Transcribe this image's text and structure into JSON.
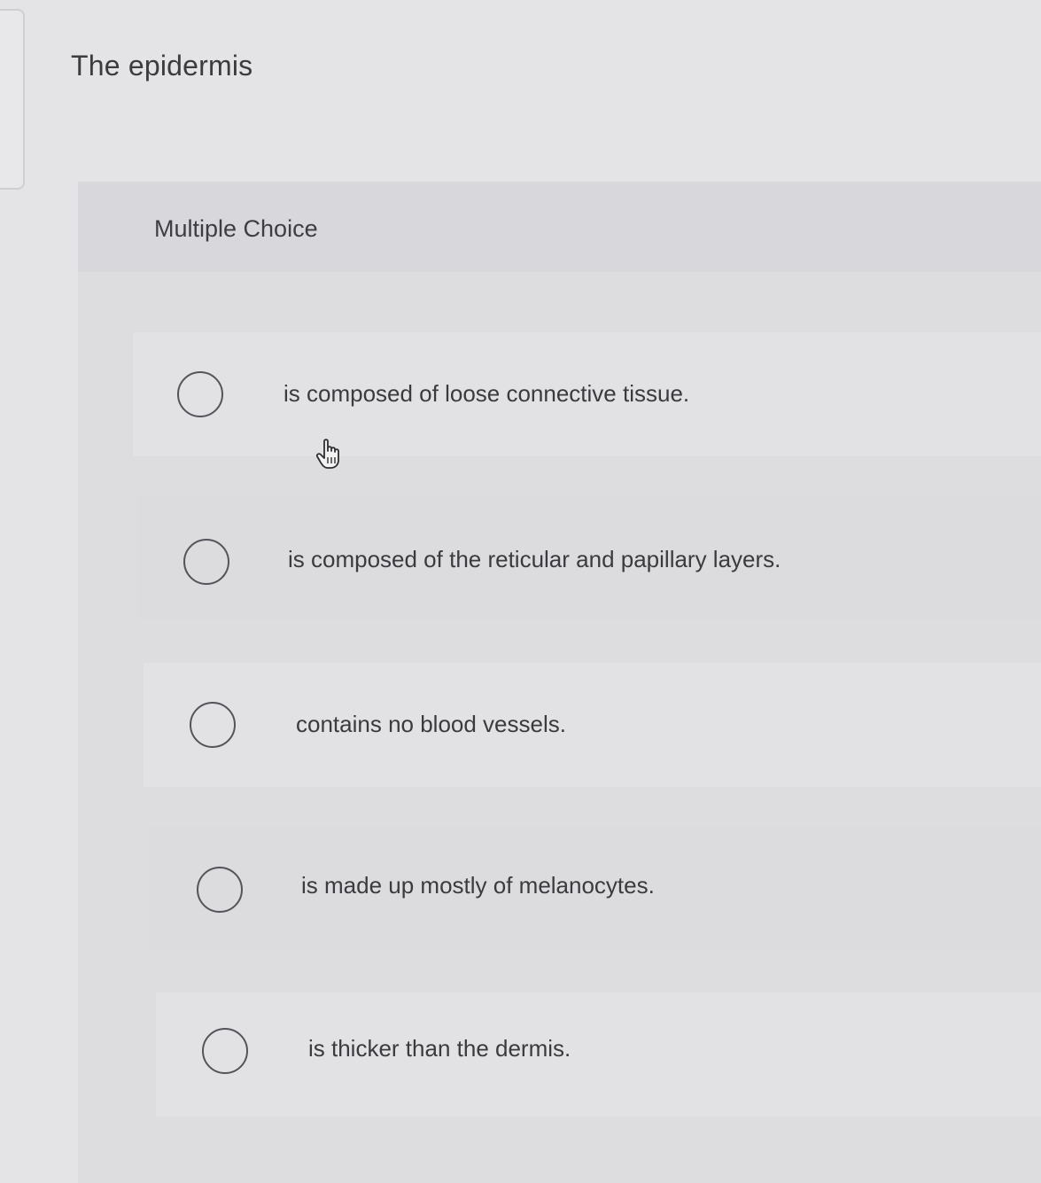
{
  "question": {
    "prompt": "The epidermis"
  },
  "multiple_choice": {
    "header_label": "Multiple Choice",
    "options": [
      {
        "label": "is composed of loose connective tissue.",
        "selected": false
      },
      {
        "label": "is composed of the reticular and papillary layers.",
        "selected": false
      },
      {
        "label": "contains no blood vessels.",
        "selected": false
      },
      {
        "label": "is made up mostly of melanocytes.",
        "selected": false
      },
      {
        "label": "is thicker than the dermis.",
        "selected": false
      }
    ]
  },
  "icons": {
    "radio": "radio-button-icon",
    "cursor": "hand-pointer-icon"
  },
  "colors": {
    "background": "#e4e3e5",
    "panel": "#dddcdf",
    "text": "#3b3a3e"
  }
}
